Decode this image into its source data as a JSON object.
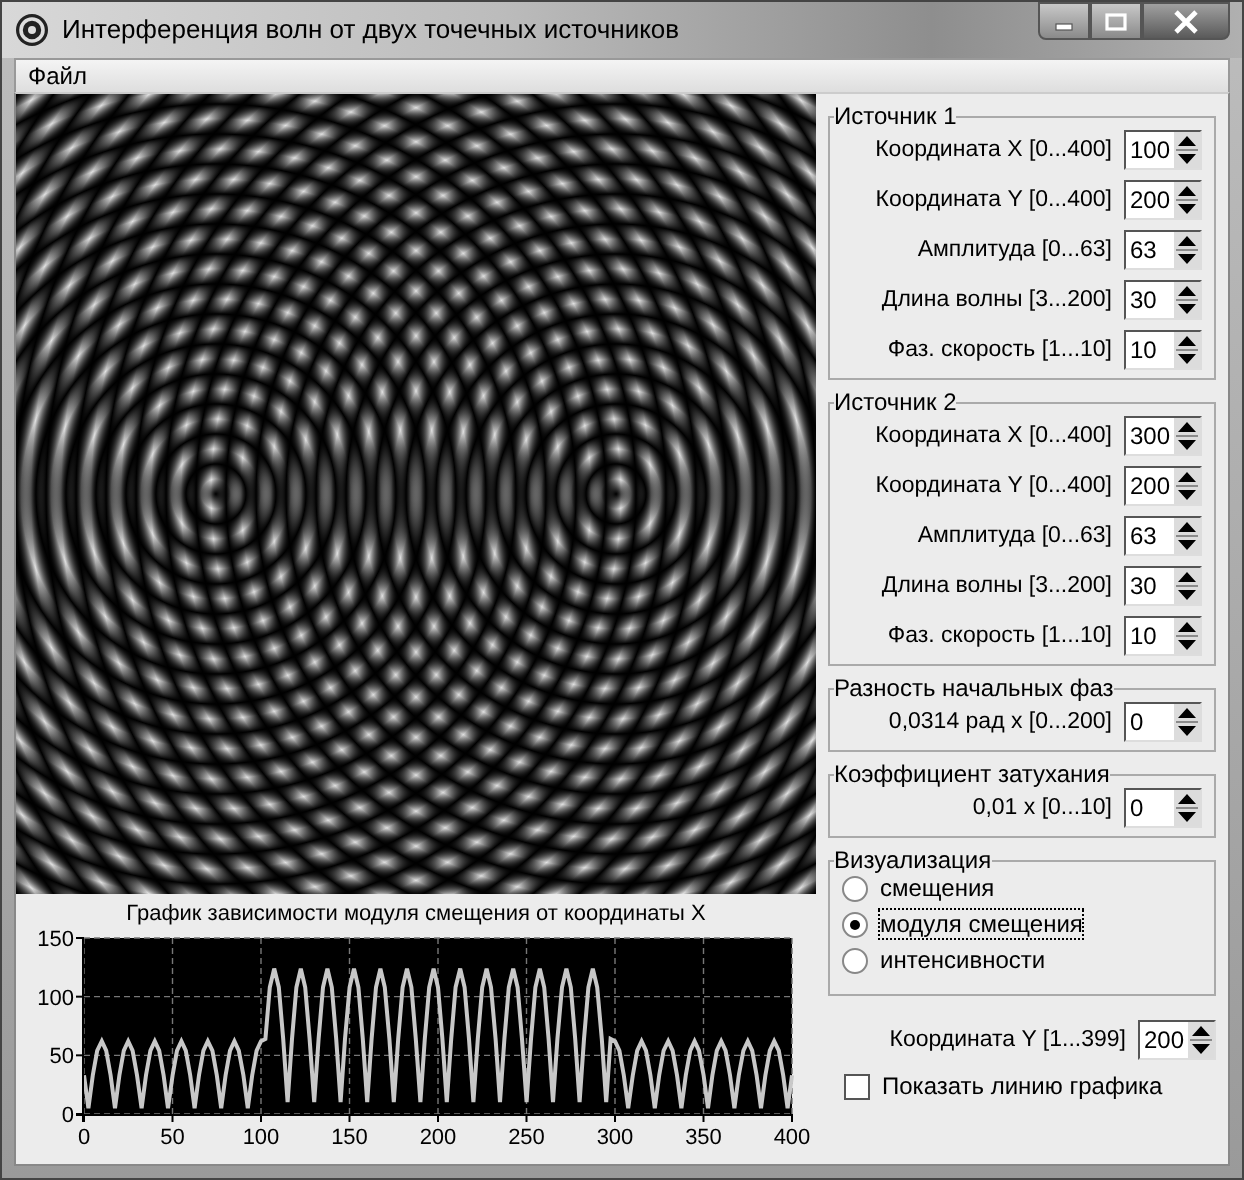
{
  "window": {
    "title": "Интерференция волн от двух точечных источников"
  },
  "menu": [
    {
      "label": "Файл"
    }
  ],
  "sources": [
    {
      "title": "Источник 1",
      "fields": [
        {
          "label": "Координата X [0...400]",
          "value": "100"
        },
        {
          "label": "Координата Y [0...400]",
          "value": "200"
        },
        {
          "label": "Амплитуда [0...63]",
          "value": "63"
        },
        {
          "label": "Длина волны [3...200]",
          "value": "30"
        },
        {
          "label": "Фаз. скорость [1...10]",
          "value": "10"
        }
      ]
    },
    {
      "title": "Источник 2",
      "fields": [
        {
          "label": "Координата X [0...400]",
          "value": "300"
        },
        {
          "label": "Координата Y [0...400]",
          "value": "200"
        },
        {
          "label": "Амплитуда [0...63]",
          "value": "63"
        },
        {
          "label": "Длина волны [3...200]",
          "value": "30"
        },
        {
          "label": "Фаз. скорость [1...10]",
          "value": "10"
        }
      ]
    }
  ],
  "phase_difference": {
    "title": "Разность начальных фаз",
    "label": "0,0314 рад  x  [0...200]",
    "value": "0"
  },
  "damping": {
    "title": "Коэффициент затухания",
    "label": "0,01  x  [0...10]",
    "value": "0"
  },
  "visualization": {
    "title": "Визуализация",
    "options": [
      {
        "label": "смещения",
        "selected": false
      },
      {
        "label": "модуля смещения",
        "selected": true
      },
      {
        "label": "интенсивности",
        "selected": false
      }
    ]
  },
  "coordinate_y": {
    "label": "Координата Y [1...399]",
    "value": "200"
  },
  "show_line": {
    "label": "Показать линию графика",
    "checked": false
  },
  "chart": {
    "chart_data": {
      "type": "line",
      "grid": true,
      "title": "График зависимости модуля смещения от координаты X",
      "xlim": [
        0,
        400
      ],
      "ylim": [
        0,
        150
      ],
      "xticks": [
        0,
        50,
        100,
        150,
        200,
        250,
        300,
        350,
        400
      ],
      "yticks": [
        0,
        50,
        100,
        150
      ],
      "x": [
        0,
        2.5,
        5,
        7.5,
        10,
        12.5,
        15,
        17.5,
        20,
        22.5,
        25,
        27.5,
        30,
        32.5,
        35,
        37.5,
        40,
        42.5,
        45,
        47.5,
        50,
        52.5,
        55,
        57.5,
        60,
        62.5,
        65,
        67.5,
        70,
        72.5,
        75,
        77.5,
        80,
        82.5,
        85,
        87.5,
        90,
        92.5,
        95,
        97.5,
        100,
        102.5,
        105,
        107.5,
        110,
        112.5,
        115,
        117.5,
        120,
        122.5,
        125,
        127.5,
        130,
        132.5,
        135,
        137.5,
        140,
        142.5,
        145,
        147.5,
        150,
        152.5,
        155,
        157.5,
        160,
        162.5,
        165,
        167.5,
        170,
        172.5,
        175,
        177.5,
        180,
        182.5,
        185,
        187.5,
        190,
        192.5,
        195,
        197.5,
        200,
        202.5,
        205,
        207.5,
        210,
        212.5,
        215,
        217.5,
        220,
        222.5,
        225,
        227.5,
        230,
        232.5,
        235,
        237.5,
        240,
        242.5,
        245,
        247.5,
        250,
        252.5,
        255,
        257.5,
        260,
        262.5,
        265,
        267.5,
        270,
        272.5,
        275,
        277.5,
        280,
        282.5,
        285,
        287.5,
        290,
        292.5,
        295,
        297.5,
        300,
        302.5,
        305,
        307.5,
        310,
        312.5,
        315,
        317.5,
        320,
        322.5,
        325,
        327.5,
        330,
        332.5,
        335,
        337.5,
        340,
        342.5,
        345,
        347.5,
        350,
        352.5,
        355,
        357.5,
        360,
        362.5,
        365,
        367.5,
        370,
        372.5,
        375,
        377.5,
        380,
        382.5,
        385,
        387.5,
        390,
        392.5,
        395,
        397.5,
        400
      ],
      "series": [
        {
          "color": "#c8c8c8",
          "values": [
            33,
            5,
            33,
            54,
            62,
            54,
            33,
            5,
            33,
            54,
            62,
            54,
            33,
            5,
            33,
            54,
            62,
            54,
            33,
            5,
            33,
            54,
            62,
            54,
            33,
            5,
            33,
            54,
            62,
            54,
            33,
            5,
            33,
            54,
            62,
            54,
            33,
            5,
            33,
            54,
            62,
            64,
            108,
            124,
            108,
            64,
            10,
            64,
            108,
            124,
            108,
            64,
            10,
            64,
            108,
            124,
            108,
            64,
            10,
            64,
            108,
            124,
            108,
            64,
            10,
            64,
            108,
            124,
            108,
            64,
            10,
            64,
            108,
            124,
            108,
            64,
            10,
            64,
            108,
            124,
            108,
            64,
            10,
            64,
            108,
            124,
            108,
            64,
            10,
            64,
            108,
            124,
            108,
            64,
            10,
            64,
            108,
            124,
            108,
            64,
            10,
            64,
            108,
            124,
            108,
            64,
            10,
            64,
            108,
            124,
            108,
            64,
            10,
            64,
            108,
            124,
            108,
            64,
            10,
            64,
            62,
            54,
            33,
            5,
            33,
            54,
            62,
            54,
            33,
            5,
            33,
            54,
            62,
            54,
            33,
            5,
            33,
            54,
            62,
            54,
            33,
            5,
            33,
            54,
            62,
            54,
            33,
            5,
            33,
            54,
            62,
            54,
            33,
            5,
            33,
            54,
            62,
            54,
            33,
            5,
            33
          ]
        }
      ]
    }
  }
}
